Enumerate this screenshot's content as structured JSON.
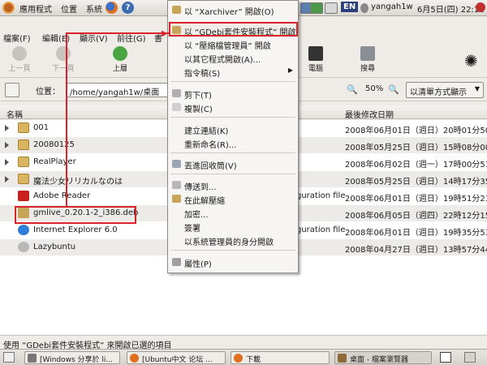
{
  "top_panel": {
    "apps_label": "應用程式",
    "places_label": "位置",
    "system_label": "系統",
    "user": "yangah1w",
    "date_time": "6月5日(四) 22:12",
    "lang_badge": "EN"
  },
  "menubar": [
    "檔案(F)",
    "編輯(E)",
    "顯示(V)",
    "前往(G)",
    "書"
  ],
  "toolbar": {
    "back": "上一頁",
    "forward": "下一頁",
    "up": "上層",
    "computer": "電腦",
    "search": "搜尋"
  },
  "location": {
    "label": "位置：",
    "path": "/home/yangah1w/桌面",
    "zoom": "50%",
    "view_mode": "以清單方式顯示"
  },
  "columns": {
    "name": "名稱",
    "modified": "最後修改日期"
  },
  "files": [
    {
      "name": "001",
      "date": "2008年06月01日（週日）20時01分50秒"
    },
    {
      "name": "20080125",
      "date": "2008年05月25日（週日）15時08分00秒"
    },
    {
      "name": "RealPlayer",
      "date": "2008年06月02日（週一）17時00分51秒"
    },
    {
      "name": "魔法少女リリカルなのは",
      "date": "2008年05月25日（週日）14時17分35秒"
    },
    {
      "name": "Adobe Reader",
      "extra": "guration file",
      "date": "2008年06月01日（週日）19時51分23秒"
    },
    {
      "name": "gmlive_0.20.1-2_i386.deb",
      "date": "2008年06月05日（週四）22時12分15秒"
    },
    {
      "name": "Internet Explorer 6.0",
      "extra": "guration file",
      "date": "2008年06月01日（週日）19時35分53秒"
    },
    {
      "name": "Lazybuntu",
      "date": "2008年04月27日（週日）13時57分44秒"
    }
  ],
  "context_menu": {
    "items": [
      "以 “Xarchiver” 開啟(O)",
      "以 “GDebi套件安裝程式” 開啟",
      "以 “壓縮檔管理員” 開啟",
      "以其它程式開啟(A)...",
      "指令稿(S)",
      "剪下(T)",
      "複製(C)",
      "建立連結(K)",
      "重新命名(R)...",
      "丟進回收筒(V)",
      "傳送到...",
      "在此解壓縮",
      "加密...",
      "簽署",
      "以系統管理員的身分開啟",
      "屬性(P)"
    ]
  },
  "status": "使用 “GDebi套件安裝程式” 來開啟已選的項目",
  "tasks": [
    "[Windows 分享於 li...",
    "[Ubuntu中文 论坛 ...",
    "下載",
    "桌面 - 檔案瀏覽器"
  ],
  "colors": {
    "annotation": "#d9232b",
    "folder": "#d9b562"
  }
}
